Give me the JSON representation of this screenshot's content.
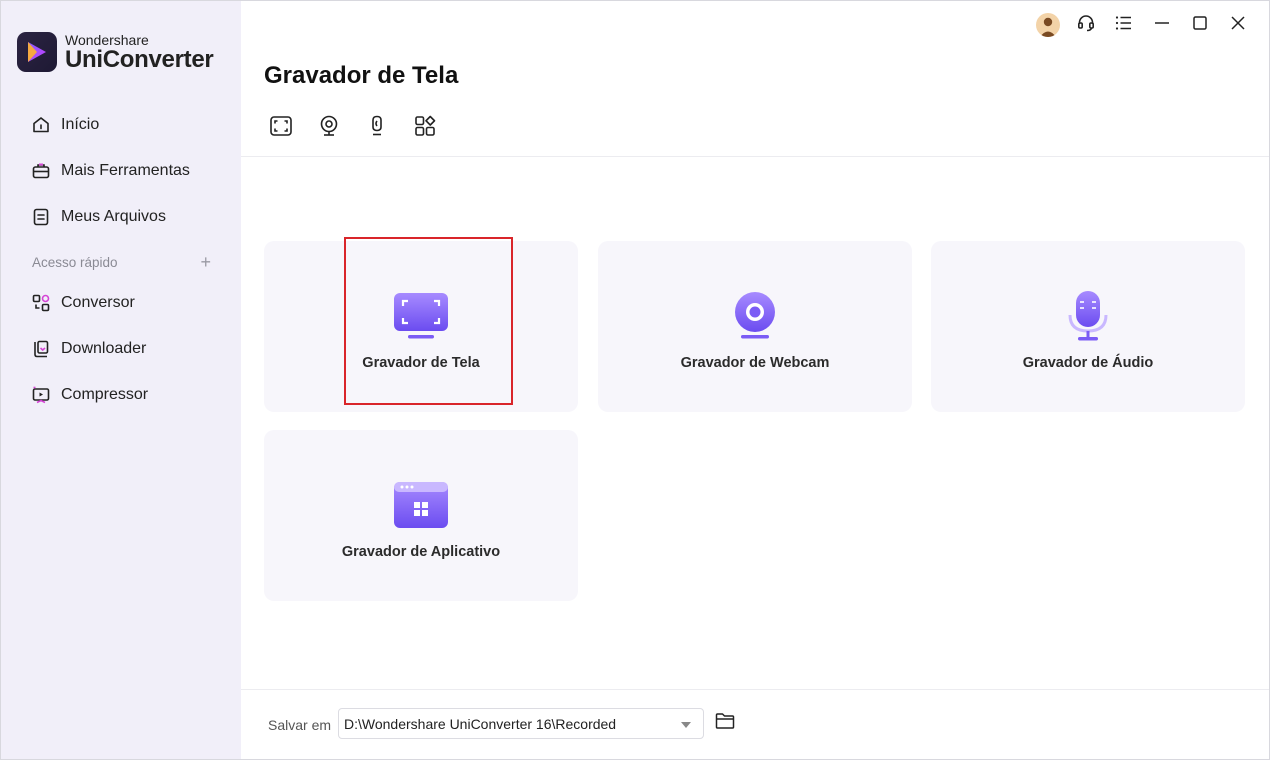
{
  "app": {
    "brand_top": "Wondershare",
    "brand_main": "UniConverter",
    "accent_color": "#7b5cf5"
  },
  "sidebar": {
    "items": [
      {
        "label": "Início",
        "icon": "home-icon"
      },
      {
        "label": "Mais Ferramentas",
        "icon": "toolbox-icon"
      },
      {
        "label": "Meus Arquivos",
        "icon": "files-icon"
      }
    ],
    "quick_access_label": "Acesso rápido",
    "quick_add": "+",
    "quick_items": [
      {
        "label": "Conversor",
        "icon": "converter-icon"
      },
      {
        "label": "Downloader",
        "icon": "download-icon"
      },
      {
        "label": "Compressor",
        "icon": "compress-icon"
      }
    ]
  },
  "titlebar": {
    "icons": [
      "avatar-icon",
      "support-headset-icon",
      "menu-icon",
      "minimize-icon",
      "maximize-icon",
      "close-icon"
    ]
  },
  "main": {
    "title": "Gravador de Tela",
    "toolbar_icons": [
      "screen-record-icon",
      "webcam-icon",
      "audio-icon",
      "apps-icon"
    ],
    "cards": [
      {
        "label": "Gravador de Tela",
        "icon": "screen-recorder-icon",
        "selected": true
      },
      {
        "label": "Gravador de Webcam",
        "icon": "webcam-recorder-icon"
      },
      {
        "label": "Gravador de Áudio",
        "icon": "microphone-icon"
      },
      {
        "label": "Gravador de Aplicativo",
        "icon": "app-recorder-icon"
      }
    ]
  },
  "footer": {
    "save_label": "Salvar em",
    "save_path": "D:\\Wondershare UniConverter 16\\Recorded"
  }
}
